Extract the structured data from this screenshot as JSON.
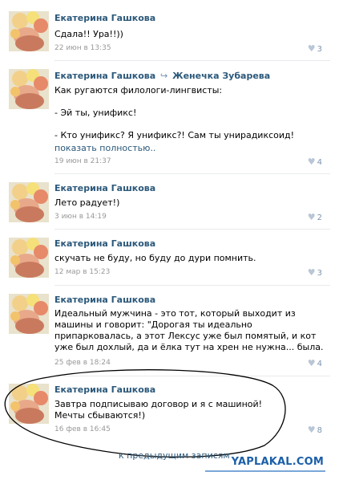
{
  "posts": [
    {
      "author": "Екатерина Гашкова",
      "repost_to": "",
      "text": "Сдала!! Ура!!))",
      "more": "",
      "date": "22 июн в 13:35",
      "likes": "3"
    },
    {
      "author": "Екатерина Гашкова",
      "repost_to": "Женечка Зубарева",
      "text": "Как ругаются филологи-лингвисты:\n\n- Эй ты, унификс!\n\n- Кто унификс? Я унификс?! Сам ты унирадиксоид!",
      "more": "показать полностью..",
      "date": "19 июн в 21:37",
      "likes": "4"
    },
    {
      "author": "Екатерина Гашкова",
      "repost_to": "",
      "text": "Лето радует!)",
      "more": "",
      "date": "3 июн в 14:19",
      "likes": "2"
    },
    {
      "author": "Екатерина Гашкова",
      "repost_to": "",
      "text": "скучать не буду, но буду до дури помнить.",
      "more": "",
      "date": "12 мар в 15:23",
      "likes": "3"
    },
    {
      "author": "Екатерина Гашкова",
      "repost_to": "",
      "text": "Идеальный мужчина - это тот, который выходит из машины и говорит: \"Дорогая ты идеально припарковалась, а этот Лексус уже был помятый, и кот уже был дохлый, да и ёлка тут на хрен не нужна... была.",
      "more": "",
      "date": "25 фев в 18:24",
      "likes": "4"
    },
    {
      "author": "Екатерина Гашкова",
      "repost_to": "",
      "text": "Завтра подписываю договор и я с машиной!\nМечты сбываются!)",
      "more": "",
      "date": "16 фев в 16:45",
      "likes": "8"
    }
  ],
  "footer": {
    "prev_link": "к предыдущим записям"
  },
  "watermark": "YAPLAKAL.COM",
  "icons": {
    "like": "heart-icon",
    "repost": "repost-arrow-icon"
  },
  "colors": {
    "link": "#2b587a",
    "date": "#999999",
    "watermark": "#1c5fa8",
    "oval_annotation": "#000000"
  }
}
